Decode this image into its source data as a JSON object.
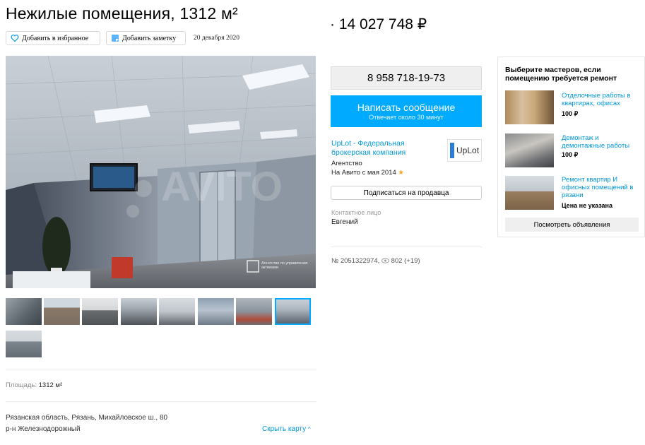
{
  "listing": {
    "title": "Нежилые помещения, 1312 м²",
    "price": "14 027 748 ₽",
    "favorite_label": "Добавить в избранное",
    "note_label": "Добавить заметку",
    "date": "20 декабря 2020",
    "ad_number": "№ 2051322974,",
    "views": "802 (+19)"
  },
  "contact": {
    "phone": "8 958 718-19-73",
    "message_label": "Написать сообщение",
    "message_sub": "Отвечает около 30 минут",
    "seller_name": "UpLot - Федеральная брокерская компания",
    "seller_type": "Агентство",
    "since": "На Авито с мая 2014",
    "logo_text": "UpLot",
    "subscribe_label": "Подписаться на продавца",
    "contact_label": "Контактное лицо",
    "contact_name": "Евгений"
  },
  "services": {
    "title": "Выберите мастеров, если помещению требуется ремонт",
    "items": [
      {
        "name": "Отделочные работы в квартирах, офисах",
        "price": "100 ₽"
      },
      {
        "name": "Демонтаж и демонтажные работы",
        "price": "100 ₽"
      },
      {
        "name": "Ремонт квартир И офисных помещений в рязани",
        "price": "Цена не указана"
      }
    ],
    "view_all_label": "Посмотреть объявления"
  },
  "params": {
    "area_label": "Площадь:",
    "area_value": "1312 м²"
  },
  "location": {
    "address": "Рязанская область, Рязань, Михайловское ш., 80",
    "district": "р-н Железнодорожный",
    "hide_map": "Скрыть карту"
  },
  "photo": {
    "watermark_text": "Агентство по управлению активами"
  },
  "icons": {
    "favorite": "heart-icon",
    "note": "note-icon",
    "views": "eye-icon",
    "star": "star-icon",
    "chevron": "chevron-up-icon"
  },
  "colors": {
    "accent": "#00aaff",
    "link": "#0099dd"
  }
}
